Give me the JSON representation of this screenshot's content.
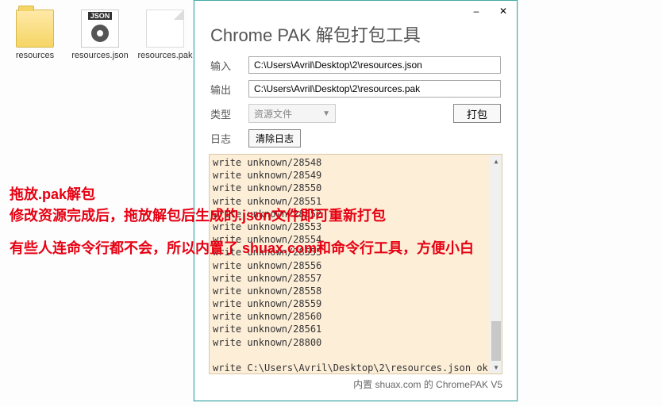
{
  "desktop": {
    "items": [
      {
        "label": "resources",
        "type": "folder"
      },
      {
        "label": "resources.json",
        "type": "json"
      },
      {
        "label": "resources.pak",
        "type": "pak"
      }
    ]
  },
  "window": {
    "title": "Chrome PAK 解包打包工具",
    "minimize": "–",
    "close": "✕",
    "labels": {
      "input": "输入",
      "output": "输出",
      "type": "类型",
      "log": "日志"
    },
    "fields": {
      "input_value": "C:\\Users\\Avril\\Desktop\\2\\resources.json",
      "output_value": "C:\\Users\\Avril\\Desktop\\2\\resources.pak",
      "type_value": "资源文件"
    },
    "buttons": {
      "pack": "打包",
      "clear_log": "清除日志"
    },
    "log_lines": [
      "write unknown/28548",
      "write unknown/28549",
      "write unknown/28550",
      "write unknown/28551",
      "write unknown/28552",
      "write unknown/28553",
      "write unknown/28554",
      "write unknown/28555",
      "write unknown/28556",
      "write unknown/28557",
      "write unknown/28558",
      "write unknown/28559",
      "write unknown/28560",
      "write unknown/28561",
      "write unknown/28800",
      "",
      "write C:\\Users\\Avril\\Desktop\\2\\resources.json ok"
    ],
    "footer": "内置 shuax.com 的 ChromePAK V5"
  },
  "overlay": {
    "line1": "拖放.pak解包",
    "line2": "修改资源完成后，拖放解包后生成的.json文件即可重新打包",
    "line3": "有些人连命令行都不会，所以内置了 shuax.com和命令行工具，方便小白"
  }
}
